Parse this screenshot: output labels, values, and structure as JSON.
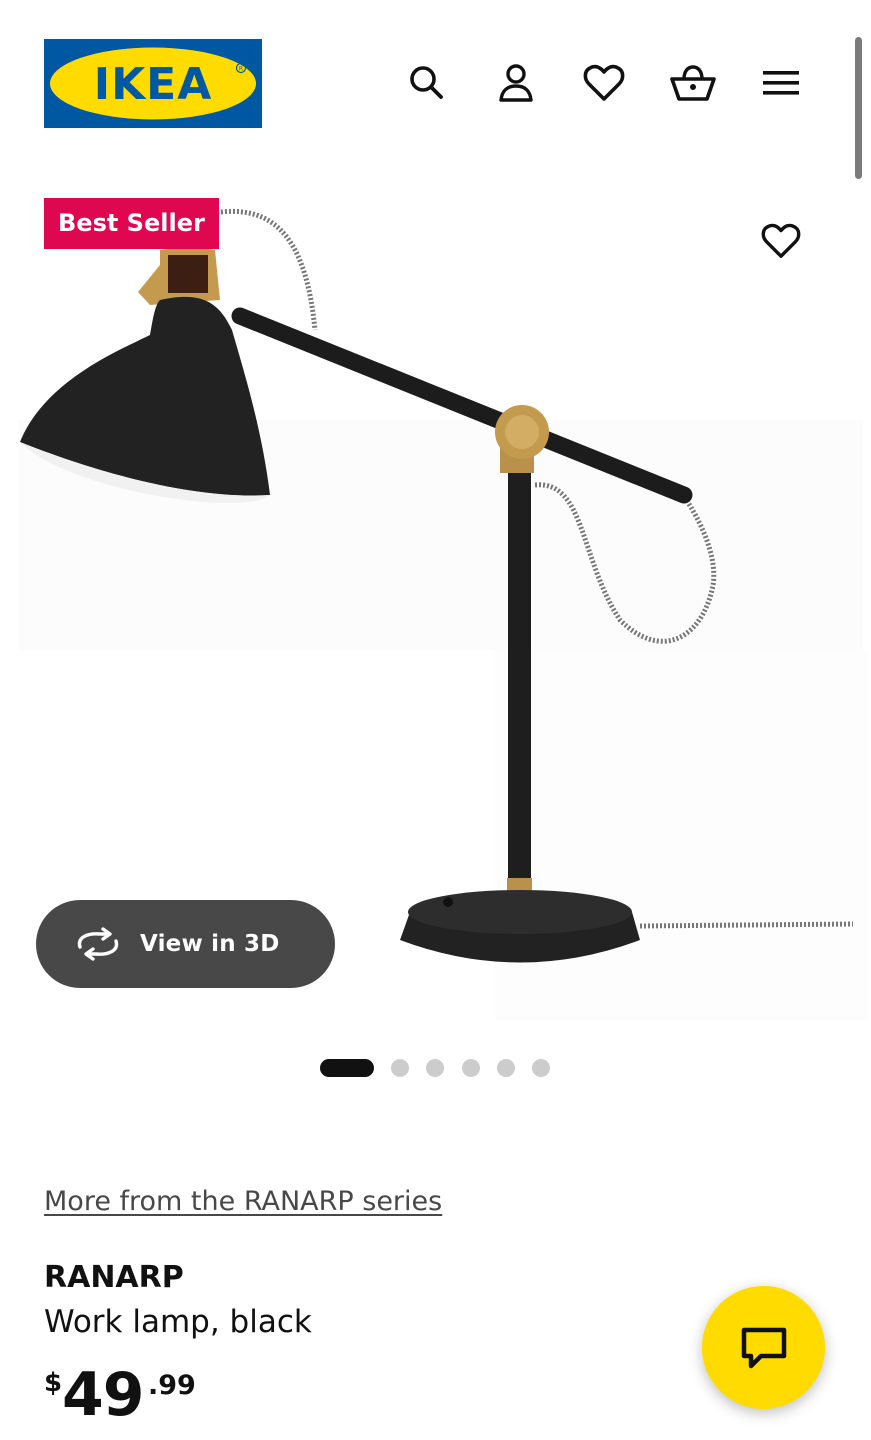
{
  "brand": {
    "logo_text": "IKEA",
    "logo_blue": "#0058a3",
    "logo_yellow": "#ffdb00"
  },
  "header": {
    "icons": [
      "search-icon",
      "account-icon",
      "heart-icon",
      "basket-icon",
      "menu-icon"
    ]
  },
  "product_media": {
    "badge": "Best Seller",
    "badge_color": "#e00751",
    "view_3d_label": "View in 3D",
    "carousel": {
      "total": 6,
      "active": 1
    }
  },
  "product": {
    "series_link": "More from the RANARP series",
    "name": "RANARP",
    "description": "Work lamp, black",
    "price": {
      "currency": "$",
      "integer": "49",
      "decimal": ".99"
    }
  },
  "chat": {
    "icon": "chat-icon",
    "color": "#ffdb00"
  }
}
